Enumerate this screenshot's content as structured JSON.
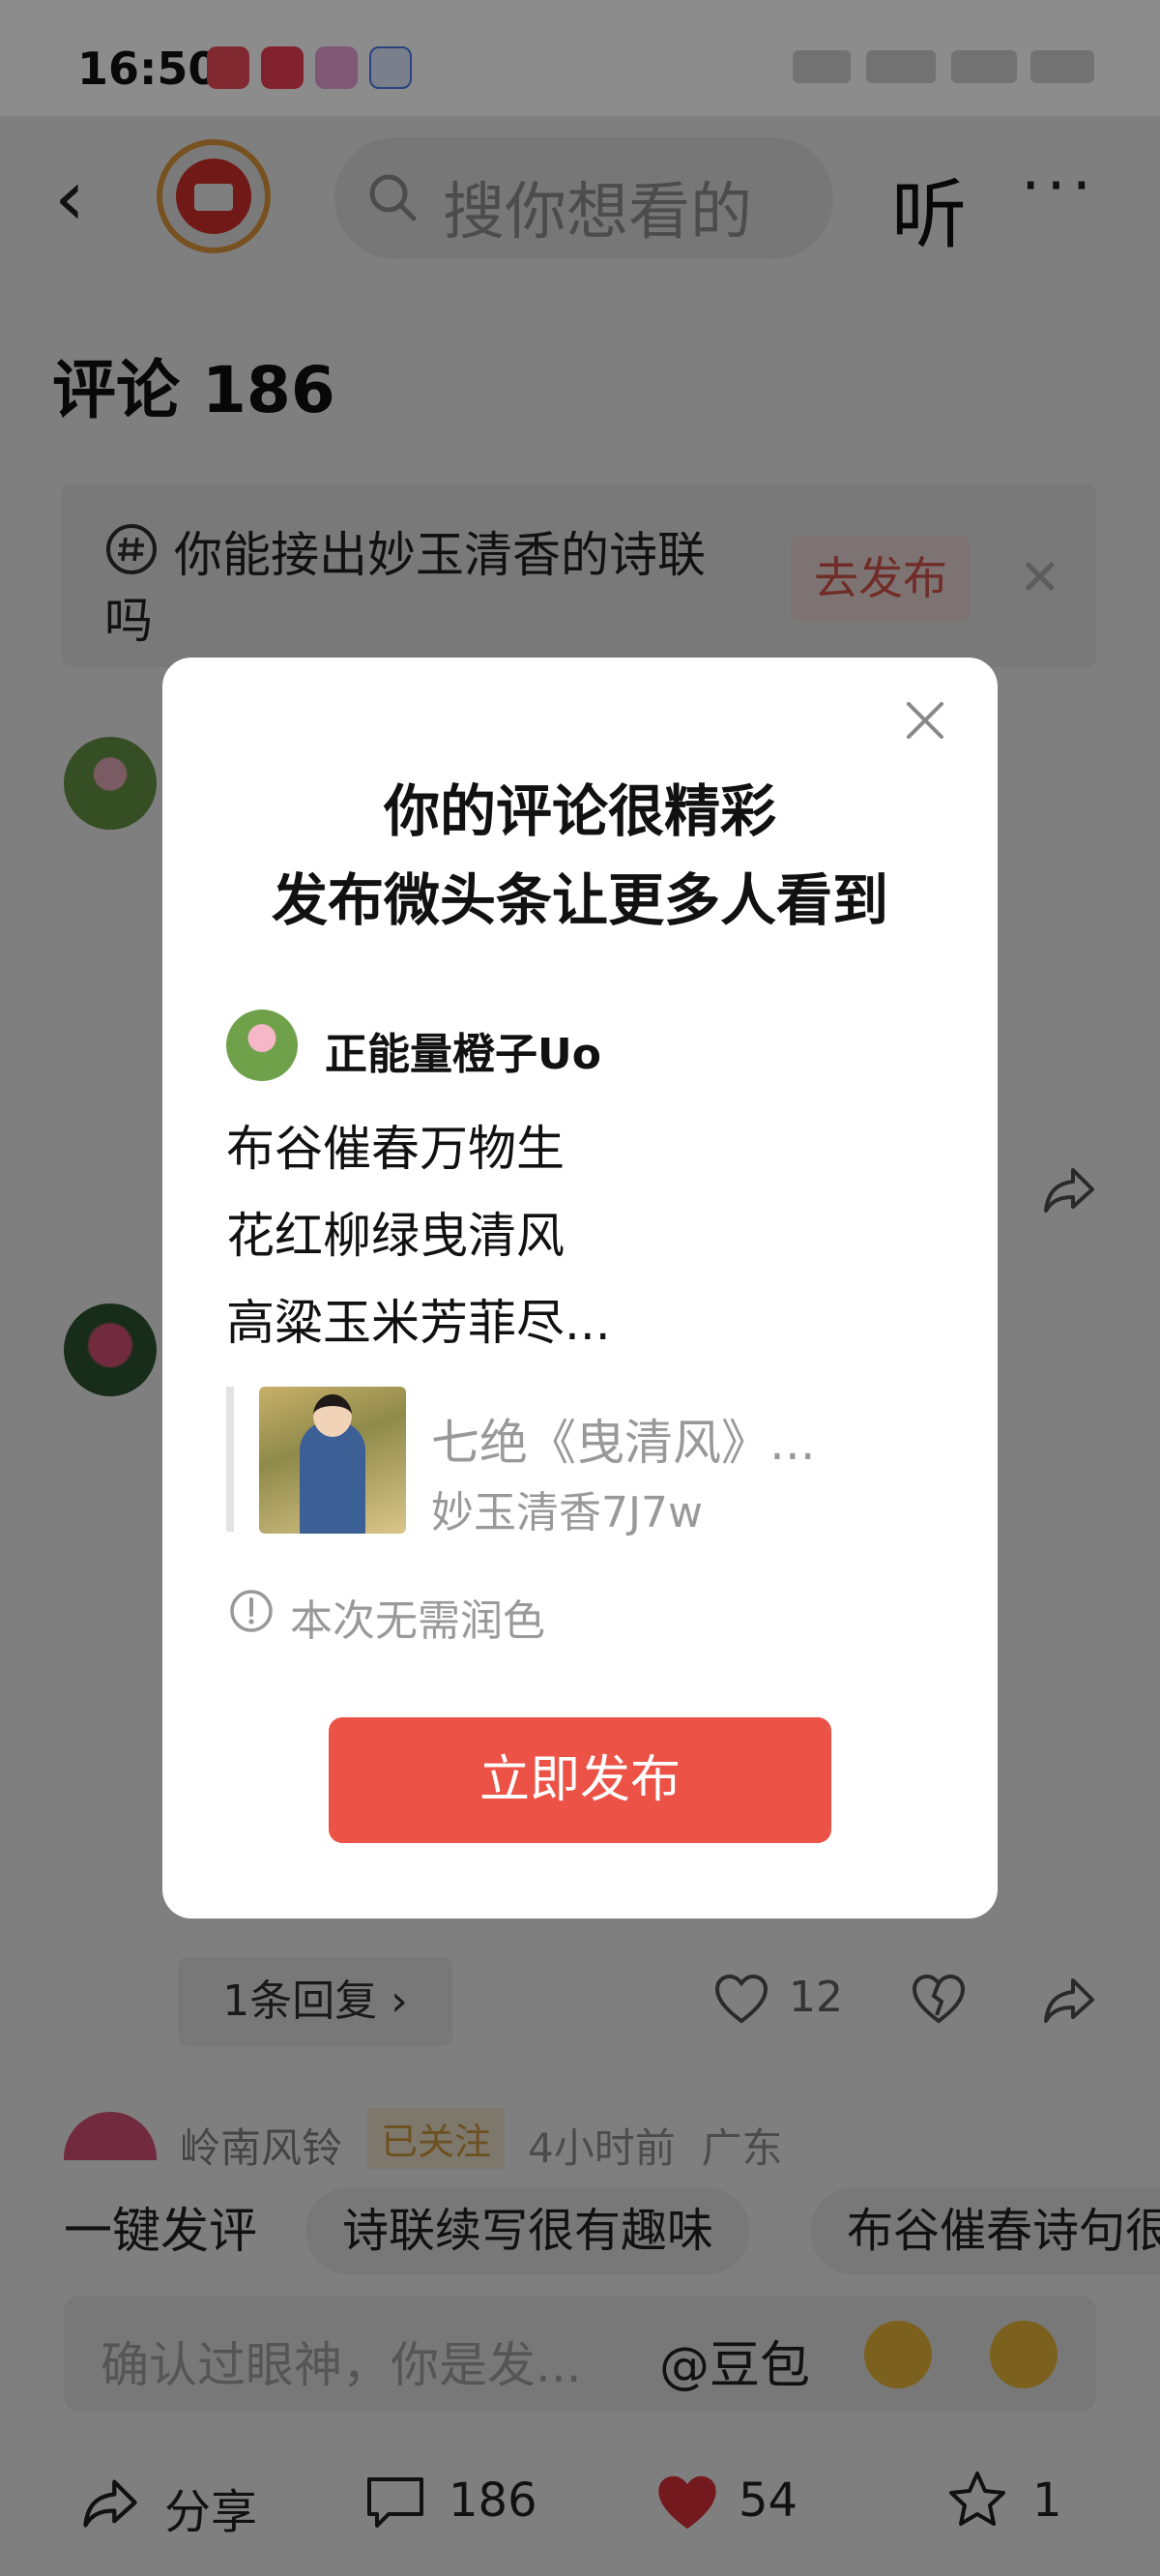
{
  "status_bar": {
    "time": "16:50"
  },
  "header": {
    "search_placeholder": "搜你想看的",
    "listen_label": "听",
    "more_label": "···"
  },
  "comments": {
    "title": "评论 186"
  },
  "topic": {
    "text": "你能接出妙玉清香的诗联吗",
    "button": "去发布"
  },
  "thread": {
    "reply_pill": "1条回复 ›",
    "like_count": "12",
    "third_comment": {
      "name": "岭南风铃",
      "followed": "已关注",
      "time": "4小时前",
      "location": "广东"
    }
  },
  "chips": {
    "plain": "一键发评",
    "items": [
      "诗联续写很有趣味",
      "布谷催春诗句很"
    ]
  },
  "input": {
    "placeholder": "确认过眼神，你是发...",
    "mention": "@豆包"
  },
  "bottom_bar": {
    "share": "分享",
    "comments": "186",
    "likes": "54",
    "favorites": "1"
  },
  "modal": {
    "title_line1": "你的评论很精彩",
    "title_line2": "发布微头条让更多人看到",
    "username": "正能量橙子Uo",
    "lines": [
      "布谷催春万物生",
      "花红柳绿曳清风",
      "高粱玉米芳菲尽..."
    ],
    "quote_title": "七绝《曳清风》...",
    "quote_author": "妙玉清香7J7w",
    "notice": "本次无需润色",
    "publish_button": "立即发布"
  },
  "colors": {
    "primary_red": "#ec5246",
    "overlay": "rgba(0,0,0,0.5)",
    "accent_orange": "#f0a340"
  }
}
